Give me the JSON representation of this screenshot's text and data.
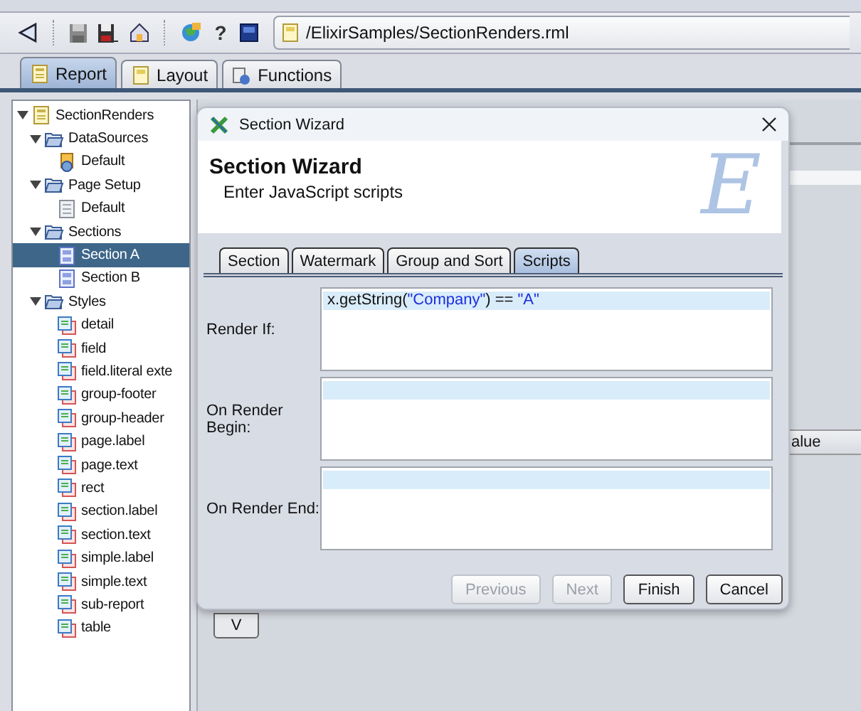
{
  "toolbar": {
    "help_glyph": "?",
    "path": "/ElixirSamples/SectionRenders.rml"
  },
  "tabs": [
    {
      "label": "Report",
      "selected": true,
      "kind": "report"
    },
    {
      "label": "Layout",
      "selected": false,
      "kind": "layout"
    },
    {
      "label": "Functions",
      "selected": false,
      "kind": "functions"
    }
  ],
  "tree": [
    {
      "label": "SectionRenders",
      "kind": "report",
      "expanded": true,
      "selected": false,
      "children": [
        {
          "label": "DataSources",
          "kind": "folder",
          "expanded": true,
          "selected": false,
          "children": [
            {
              "label": "Default",
              "kind": "datasource",
              "selected": false
            }
          ]
        },
        {
          "label": "Page Setup",
          "kind": "folder",
          "expanded": true,
          "selected": false,
          "children": [
            {
              "label": "Default",
              "kind": "page",
              "selected": false
            }
          ]
        },
        {
          "label": "Sections",
          "kind": "folder",
          "expanded": true,
          "selected": false,
          "children": [
            {
              "label": "Section A",
              "kind": "section",
              "selected": true
            },
            {
              "label": "Section B",
              "kind": "section",
              "selected": false
            }
          ]
        },
        {
          "label": "Styles",
          "kind": "folder",
          "expanded": true,
          "selected": false,
          "children": [
            {
              "label": "detail",
              "kind": "style",
              "selected": false
            },
            {
              "label": "field",
              "kind": "style",
              "selected": false
            },
            {
              "label": "field.literal exte",
              "kind": "style",
              "selected": false
            },
            {
              "label": "group-footer",
              "kind": "style",
              "selected": false
            },
            {
              "label": "group-header",
              "kind": "style",
              "selected": false
            },
            {
              "label": "page.label",
              "kind": "style",
              "selected": false
            },
            {
              "label": "page.text",
              "kind": "style",
              "selected": false
            },
            {
              "label": "rect",
              "kind": "style",
              "selected": false
            },
            {
              "label": "section.label",
              "kind": "style",
              "selected": false
            },
            {
              "label": "section.text",
              "kind": "style",
              "selected": false
            },
            {
              "label": "simple.label",
              "kind": "style",
              "selected": false
            },
            {
              "label": "simple.text",
              "kind": "style",
              "selected": false
            },
            {
              "label": "sub-report",
              "kind": "style",
              "selected": false
            },
            {
              "label": "table",
              "kind": "style",
              "selected": false
            }
          ]
        }
      ]
    }
  ],
  "background": {
    "column_header": "alue",
    "button": "V"
  },
  "dialog": {
    "title": "Section Wizard",
    "heading": "Section Wizard",
    "subheading": "Enter JavaScript scripts",
    "logo_letter": "E",
    "tabs": [
      {
        "label": "Section",
        "selected": false
      },
      {
        "label": "Watermark",
        "selected": false
      },
      {
        "label": "Group and Sort",
        "selected": false
      },
      {
        "label": "Scripts",
        "selected": true
      }
    ],
    "fields": [
      {
        "label": "Render If:",
        "code": [
          {
            "kind": "plain",
            "text": "x.getString("
          },
          {
            "kind": "string",
            "text": "\"Company\""
          },
          {
            "kind": "plain",
            "text": ") == "
          },
          {
            "kind": "string",
            "text": "\"A\""
          }
        ]
      },
      {
        "label": "On Render Begin:"
      },
      {
        "label": "On Render End:"
      }
    ],
    "buttons": [
      {
        "label": "Previous",
        "disabled": true
      },
      {
        "label": "Next",
        "disabled": true
      },
      {
        "label": "Finish",
        "disabled": false
      },
      {
        "label": "Cancel",
        "disabled": false
      }
    ]
  }
}
